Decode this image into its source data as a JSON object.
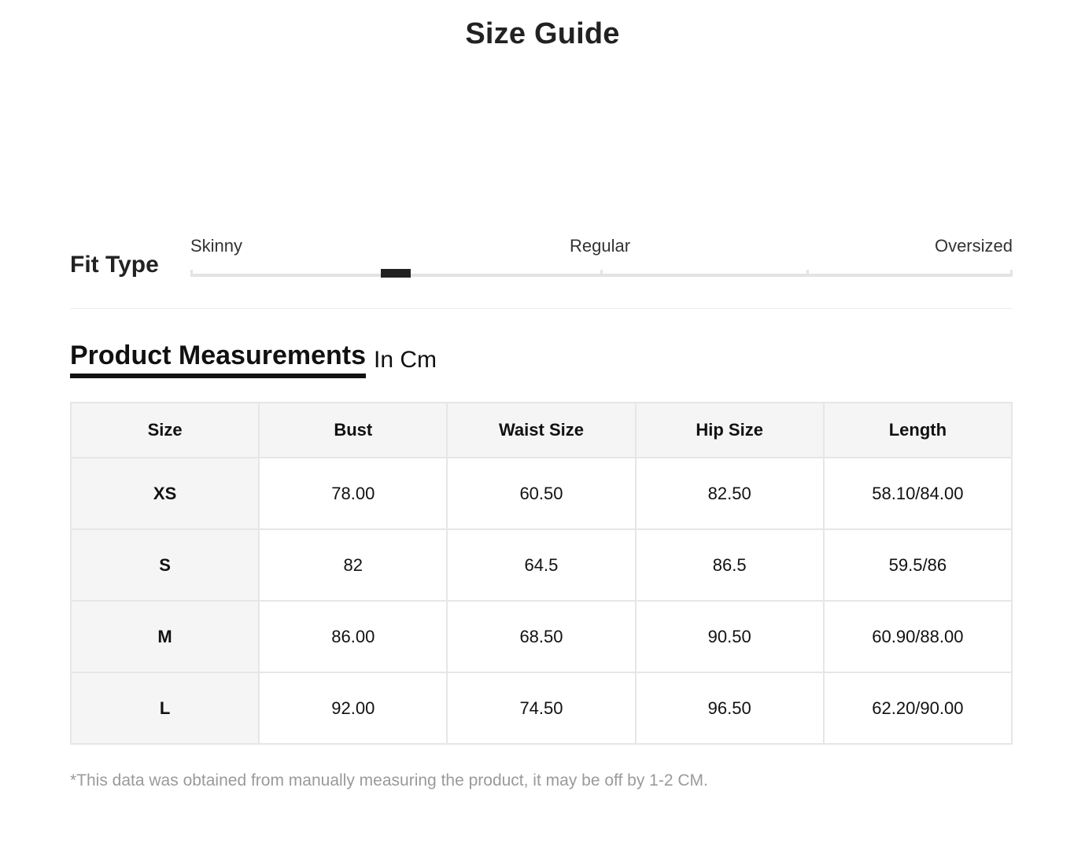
{
  "title": "Size Guide",
  "fit_type": {
    "label": "Fit Type",
    "scale_labels": {
      "left": "Skinny",
      "middle": "Regular",
      "right": "Oversized"
    },
    "marker_position": 0.25
  },
  "measurements": {
    "title": "Product Measurements",
    "unit": "In Cm",
    "headers": [
      "Size",
      "Bust",
      "Waist Size",
      "Hip Size",
      "Length"
    ],
    "rows": [
      [
        "XS",
        "78.00",
        "60.50",
        "82.50",
        "58.10/84.00"
      ],
      [
        "S",
        "82",
        "64.5",
        "86.5",
        "59.5/86"
      ],
      [
        "M",
        "86.00",
        "68.50",
        "90.50",
        "60.90/88.00"
      ],
      [
        "L",
        "92.00",
        "74.50",
        "96.50",
        "62.20/90.00"
      ]
    ]
  },
  "note": "*This data was obtained from manually measuring the product, it may be off by 1-2 CM.",
  "colors": {
    "text": "#222222",
    "marker": "#222222",
    "track": "#e3e3e3",
    "header_bg": "#f5f5f5",
    "note": "#9a9a9a"
  }
}
